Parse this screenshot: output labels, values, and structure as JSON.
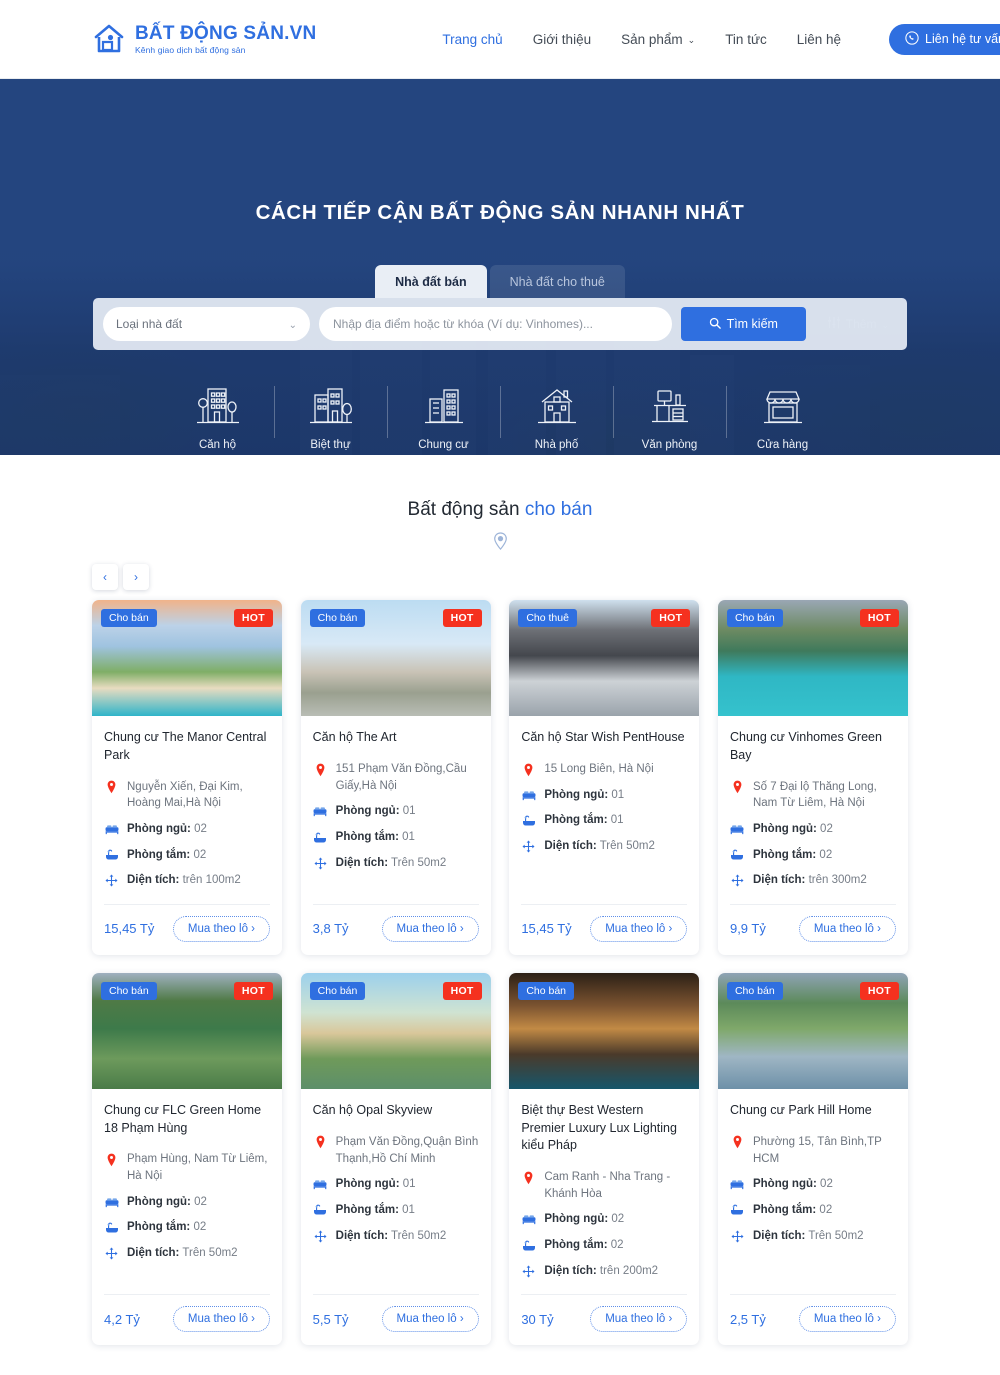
{
  "header": {
    "logo": {
      "title": "BẤT ĐỘNG SẢN.VN",
      "subtitle": "Kênh giao dịch bất động sản",
      "icon": "house-logo-icon"
    },
    "nav": [
      {
        "label": "Trang chủ",
        "active": true
      },
      {
        "label": "Giới thiệu",
        "active": false
      },
      {
        "label": "Sản phẩm",
        "active": false,
        "caret": "⌄"
      },
      {
        "label": "Tin tức",
        "active": false
      },
      {
        "label": "Liên hệ",
        "active": false
      }
    ],
    "cta": {
      "label": "Liên hệ tư vấn",
      "icon": "phone-icon"
    }
  },
  "hero": {
    "title": "CÁCH TIẾP CẬN BẤT ĐỘNG SẢN NHANH NHẤT",
    "tabs": [
      {
        "label": "Nhà đất bán",
        "active": true
      },
      {
        "label": "Nhà đất cho thuê",
        "active": false
      }
    ],
    "search": {
      "type_select": {
        "value": "Loại nhà đất",
        "caret": "⌄"
      },
      "keyword": {
        "value": "",
        "placeholder": "Nhập địa điểm hoặc từ khóa (Ví dụ: Vinhomes)..."
      },
      "search_button": {
        "label": "Tìm kiếm",
        "icon": "search-icon"
      },
      "more_button": {
        "label": "Thêm",
        "icon": "filter-sliders-icon",
        "caret": "⌄"
      }
    },
    "categories": [
      {
        "label": "Căn hộ",
        "icon": "apartment-block-icon"
      },
      {
        "label": "Biệt thự",
        "icon": "villa-icon"
      },
      {
        "label": "Chung cư",
        "icon": "condo-towers-icon"
      },
      {
        "label": "Nhà phố",
        "icon": "townhouse-icon"
      },
      {
        "label": "Văn phòng",
        "icon": "office-desk-icon"
      },
      {
        "label": "Cửa hàng",
        "icon": "storefront-icon"
      }
    ]
  },
  "listing": {
    "title_plain": "Bất động sản ",
    "title_highlight": "cho bán",
    "divider_icon": "map-pin-icon",
    "carousel": {
      "prev": "‹",
      "next": "›"
    },
    "labels": {
      "bedrooms": "Phòng ngủ:",
      "bathrooms": "Phòng tắm:",
      "area": "Diện tích:",
      "lot_button": "Mua theo lô ›"
    },
    "colors": {
      "accent": "#2f6fe0",
      "hot": "#f5311f",
      "hero": "#24457f"
    },
    "cards": [
      {
        "badge": "Cho bán",
        "hot": "HOT",
        "image": "riverside-apartment-towers",
        "title": "Chung cư The Manor Central Park",
        "address": "Nguyễn Xiến, Đại Kim, Hoàng Mai,Hà Nội",
        "bedrooms": "02",
        "bathrooms": "02",
        "area": "trên 100m2",
        "price": "15,45 Tỷ"
      },
      {
        "badge": "Cho bán",
        "hot": "HOT",
        "image": "highrise-towers-daylight",
        "title": "Căn hộ The Art",
        "address": "151 Phạm Văn Đồng,Cầu Giấy,Hà Nội",
        "bedrooms": "01",
        "bathrooms": "01",
        "area": "Trên 50m2",
        "price": "3,8 Tỷ"
      },
      {
        "badge": "Cho thuê",
        "hot": "HOT",
        "image": "modern-penthouse-terrace",
        "title": "Căn hộ Star Wish PentHouse",
        "address": "15 Long Biên, Hà Nội",
        "bedrooms": "01",
        "bathrooms": "01",
        "area": "Trên 50m2",
        "price": "15,45 Tỷ"
      },
      {
        "badge": "Cho bán",
        "hot": "HOT",
        "image": "lagoon-aerial-greenbay",
        "title": "Chung cư Vinhomes Green Bay",
        "address": "Số 7 Đại lộ Thăng Long, Nam Từ Liêm, Hà Nội",
        "bedrooms": "02",
        "bathrooms": "02",
        "area": "trên 300m2",
        "price": "9,9 Tỷ"
      },
      {
        "badge": "Cho bán",
        "hot": "HOT",
        "image": "green-park-walkways-aerial",
        "title": "Chung cư FLC Green Home 18 Phạm Hùng",
        "address": "Phạm Hùng, Nam Từ Liêm, Hà Nội",
        "bedrooms": "02",
        "bathrooms": "02",
        "area": "Trên 50m2",
        "price": "4,2 Tỷ"
      },
      {
        "badge": "Cho bán",
        "hot": "HOT",
        "image": "lakeside-villas-garden",
        "title": "Căn hộ Opal Skyview",
        "address": "Phạm Văn Đồng,Quận Bình Thạnh,Hồ Chí Minh",
        "bedrooms": "01",
        "bathrooms": "01",
        "area": "Trên 50m2",
        "price": "5,5 Tỷ"
      },
      {
        "badge": "Cho bán",
        "hot": "",
        "image": "luxury-mansion-pool-night",
        "title": "Biệt thự Best Western Premier Luxury Lux Lighting kiểu Pháp",
        "address": "Cam Ranh - Nha Trang - Khánh Hòa",
        "bedrooms": "02",
        "bathrooms": "02",
        "area": "trên 200m2",
        "price": "30 Tỷ"
      },
      {
        "badge": "Cho bán",
        "hot": "HOT",
        "image": "urban-rooftop-garden-aerial",
        "title": "Chung cư Park Hill Home",
        "address": "Phường 15, Tân Bình,TP HCM",
        "bedrooms": "02",
        "bathrooms": "02",
        "area": "Trên 50m2",
        "price": "2,5 Tỷ"
      }
    ]
  }
}
